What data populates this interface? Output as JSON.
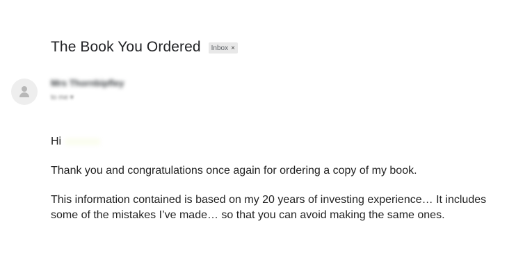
{
  "email": {
    "subject": "The Book You Ordered",
    "label": "Inbox",
    "label_remove": "×",
    "sender_name": "Mrs Thornbipfley",
    "recipient": "to me ▾",
    "greeting": "Hi",
    "paragraphs": [
      "Thank you and congratulations once again for ordering a copy of my book.",
      "This information contained is based on my 20 years of investing experience… It includes some of the mistakes I’ve made… so that you can avoid making the same ones."
    ]
  },
  "icons": {
    "avatar": "person-icon"
  }
}
